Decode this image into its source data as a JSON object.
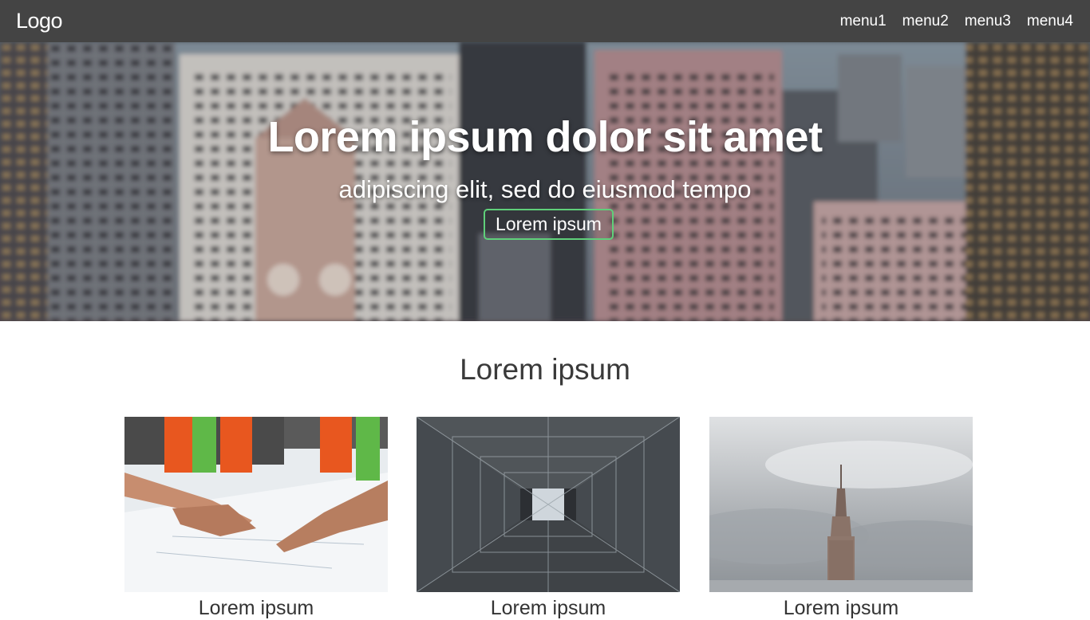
{
  "nav": {
    "logo": "Logo",
    "menu": [
      {
        "label": "menu1"
      },
      {
        "label": "menu2"
      },
      {
        "label": "menu3"
      },
      {
        "label": "menu4"
      }
    ]
  },
  "hero": {
    "title": "Lorem ipsum dolor sit amet",
    "subtitle": "adipiscing elit, sed do eiusmod tempo",
    "button_label": "Lorem ipsum",
    "button_border_color": "#5fd07a"
  },
  "section": {
    "title": "Lorem ipsum",
    "cards": [
      {
        "title": "Lorem ipsum",
        "image": "construction-workers-blueprint"
      },
      {
        "title": "Lorem ipsum",
        "image": "building-atrium-looking-up"
      },
      {
        "title": "Lorem ipsum",
        "image": "skyscraper-cloudy-sky"
      }
    ]
  },
  "colors": {
    "nav_bg": "#444444",
    "accent": "#5fd07a",
    "text": "#333333"
  }
}
